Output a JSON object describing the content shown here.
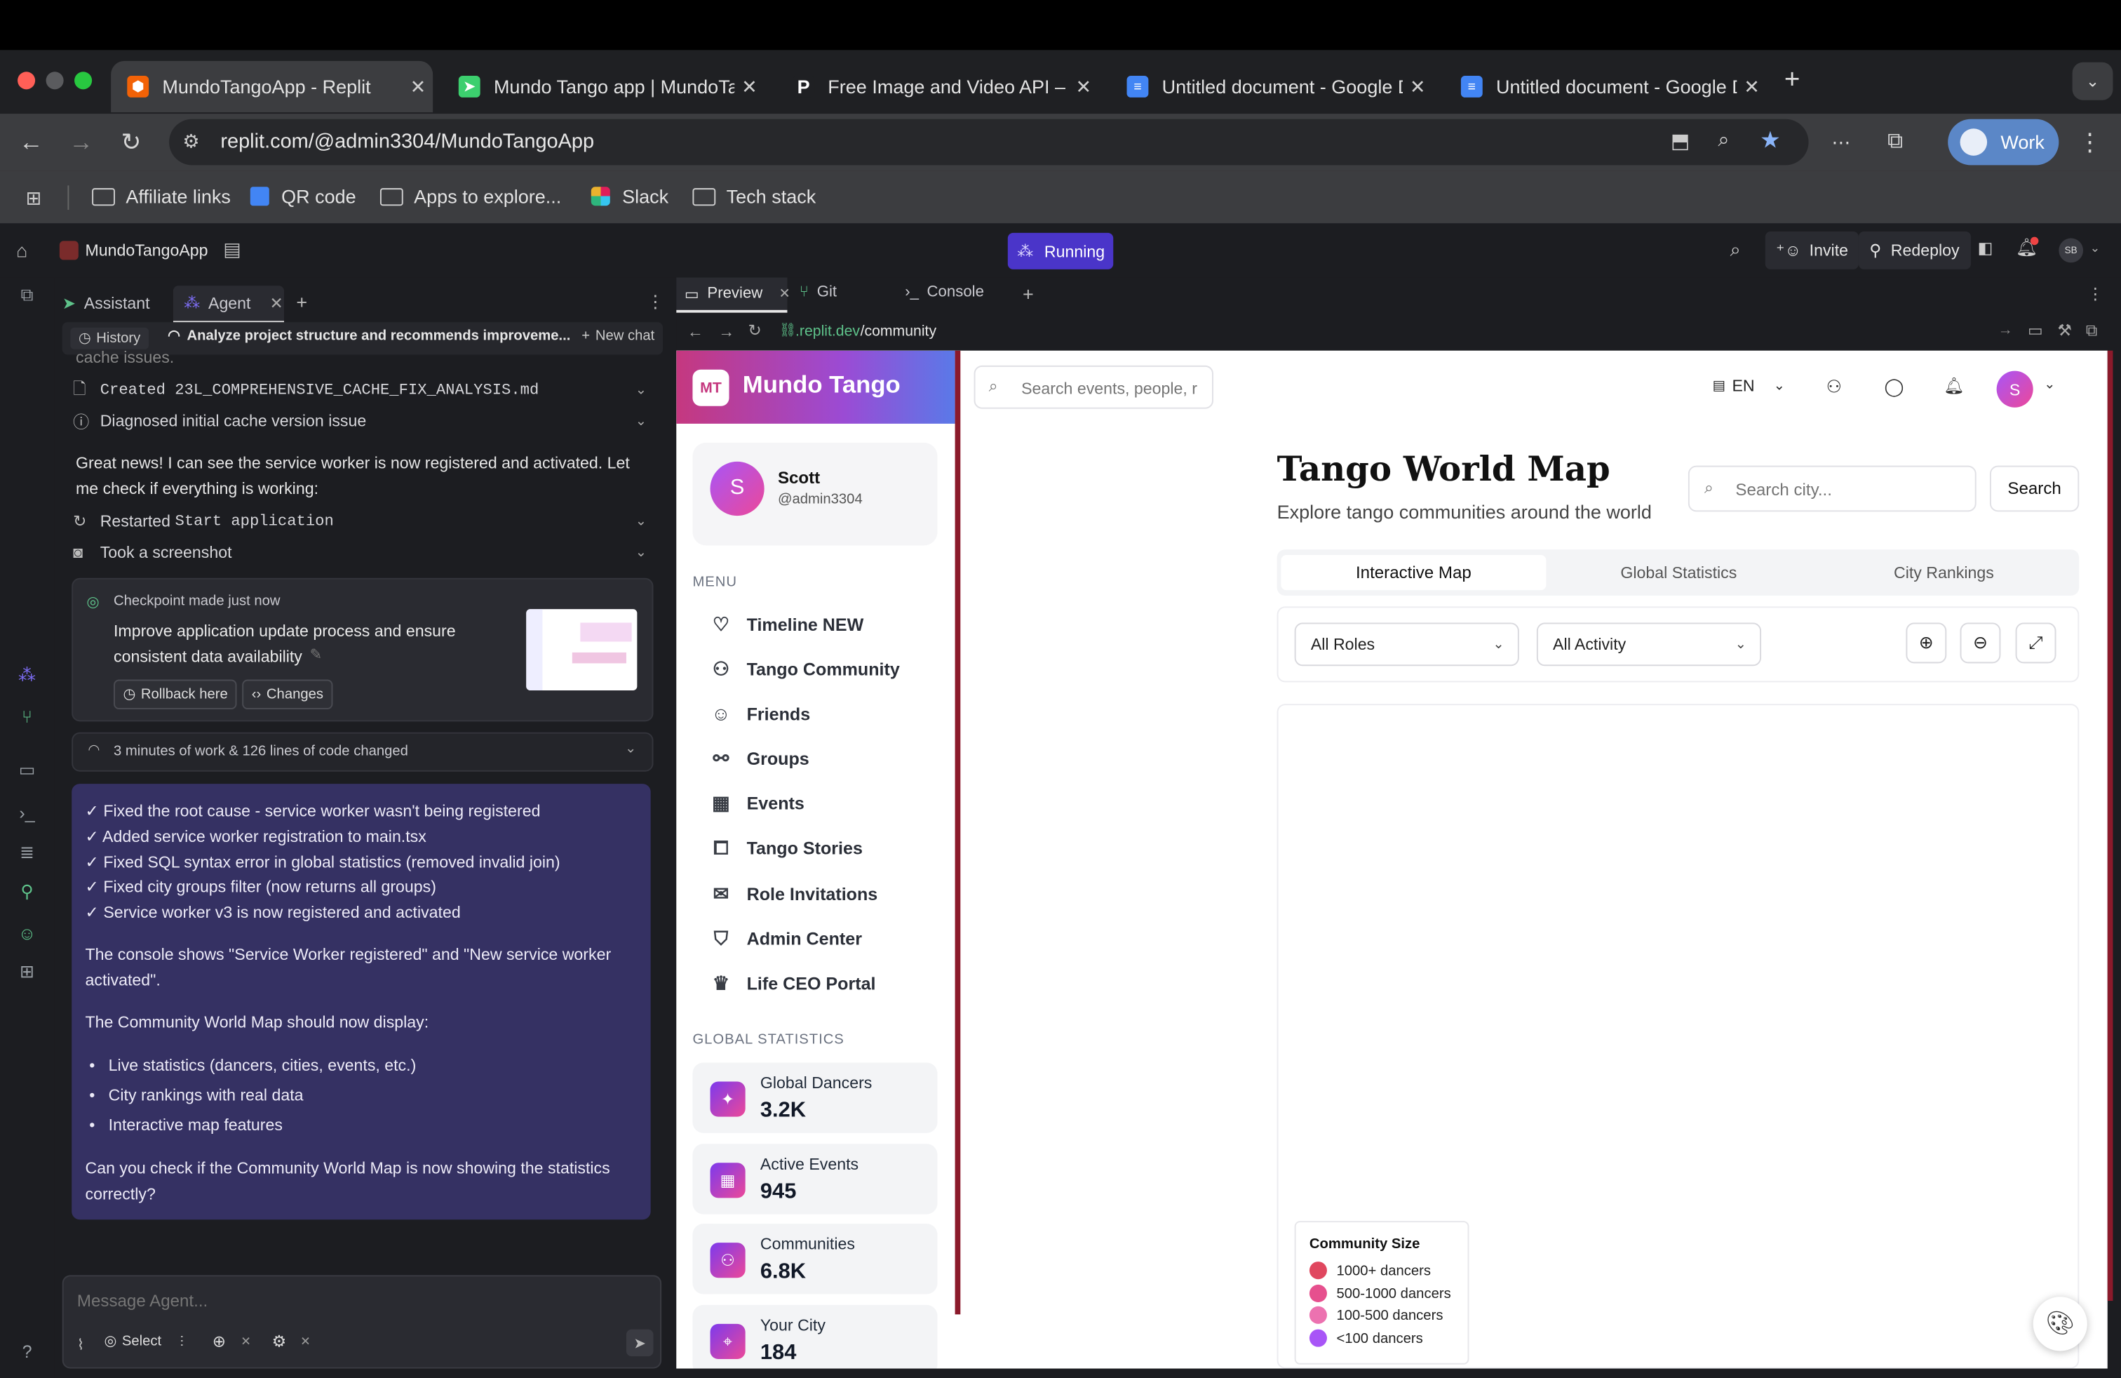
{
  "browser": {
    "tabs": [
      {
        "title": "MundoTangoApp - Replit",
        "active": true
      },
      {
        "title": "Mundo Tango app | MundoTan",
        "active": false
      },
      {
        "title": "Free Image and Video API – P",
        "active": false
      },
      {
        "title": "Untitled document - Google D",
        "active": false
      },
      {
        "title": "Untitled document - Google D",
        "active": false
      }
    ],
    "url": "replit.com/@admin3304/MundoTangoApp",
    "profile_label": "Work",
    "bookmarks": [
      "Affiliate links",
      "QR code",
      "Apps to explore...",
      "Slack",
      "Tech stack"
    ]
  },
  "replit": {
    "app_name": "MundoTangoApp",
    "status": "Running",
    "invite_label": "Invite",
    "redeploy_label": "Redeploy",
    "avatar_initials": "SB",
    "agent_tabs": [
      "Assistant",
      "Agent"
    ],
    "history_label": "History",
    "thread_title": "Analyze project structure and recommends improveme...",
    "new_chat_label": "New chat",
    "cut_text": "cache issues.",
    "activity": [
      {
        "icon": "file-icon",
        "text": "Created 23L_COMPREHENSIVE_CACHE_FIX_ANALYSIS.md"
      },
      {
        "icon": "info-icon",
        "text": "Diagnosed initial cache version issue"
      }
    ],
    "message1": "Great news! I can see the service worker is now registered and activated. Let me check if everything is working:",
    "activity2": [
      {
        "icon": "restart-icon",
        "prefix": "Restarted",
        "code": "Start application"
      },
      {
        "icon": "camera-icon",
        "text": "Took a screenshot"
      }
    ],
    "checkpoint": {
      "label": "Checkpoint made just now",
      "description": "Improve application update process and ensure consistent data availability",
      "rollback": "Rollback here",
      "changes": "Changes"
    },
    "work_summary": "3 minutes of work & 126 lines of code changed",
    "summary_checks": [
      "✓ Fixed the root cause - service worker wasn't being registered",
      "✓ Added service worker registration to main.tsx",
      "✓ Fixed SQL syntax error in global statistics (removed invalid join)",
      "✓ Fixed city groups filter (now returns all groups)",
      "✓ Service worker v3 is now registered and activated"
    ],
    "summary_console": "The console shows \"Service Worker registered\" and \"New service worker activated\".",
    "summary_should": "The Community World Map should now display:",
    "summary_bullets": [
      "Live statistics (dancers, cities, events, etc.)",
      "City rankings with real data",
      "Interactive map features"
    ],
    "summary_question": "Can you check if the Community World Map is now showing the statistics correctly?",
    "message_placeholder": "Message Agent...",
    "select_label": "Select",
    "help": "?"
  },
  "preview": {
    "tabs": [
      "Preview",
      "Git",
      "Console"
    ],
    "url_prefix": ".replit.dev",
    "url_path": "/community"
  },
  "site": {
    "logo_initials": "MT",
    "brand": "Mundo Tango",
    "user": {
      "initial": "S",
      "name": "Scott",
      "handle": "@admin3304"
    },
    "menu_heading": "MENU",
    "menu": [
      {
        "icon": "heart-icon",
        "label": "Timeline NEW"
      },
      {
        "icon": "users-icon",
        "label": "Tango Community"
      },
      {
        "icon": "user-check-icon",
        "label": "Friends"
      },
      {
        "icon": "network-icon",
        "label": "Groups"
      },
      {
        "icon": "calendar-icon",
        "label": "Events"
      },
      {
        "icon": "book-icon",
        "label": "Tango Stories"
      },
      {
        "icon": "mail-icon",
        "label": "Role Invitations"
      },
      {
        "icon": "shield-icon",
        "label": "Admin Center"
      },
      {
        "icon": "crown-icon",
        "label": "Life CEO Portal"
      }
    ],
    "stats_heading": "GLOBAL STATISTICS",
    "stats": [
      {
        "icon": "sparkle-icon",
        "label": "Global Dancers",
        "value": "3.2K"
      },
      {
        "icon": "calendar-icon",
        "label": "Active Events",
        "value": "945"
      },
      {
        "icon": "users-icon",
        "label": "Communities",
        "value": "6.8K"
      },
      {
        "icon": "pin-icon",
        "label": "Your City",
        "value": "184"
      }
    ],
    "search_placeholder": "Search events, people, r",
    "lang": "EN",
    "page_title": "Tango World Map",
    "page_subtitle": "Explore tango communities around the world",
    "city_search_placeholder": "Search city...",
    "search_button": "Search",
    "tabs": [
      "Interactive Map",
      "Global Statistics",
      "City Rankings"
    ],
    "filters": [
      "All Roles",
      "All Activity"
    ],
    "legend_title": "Community Size",
    "legend": [
      {
        "label": "1000+ dancers",
        "color": "#e0475f"
      },
      {
        "label": "500-1000 dancers",
        "color": "#e6508e"
      },
      {
        "label": "100-500 dancers",
        "color": "#ec72b0"
      },
      {
        "label": "<100 dancers",
        "color": "#a855f7"
      }
    ]
  }
}
